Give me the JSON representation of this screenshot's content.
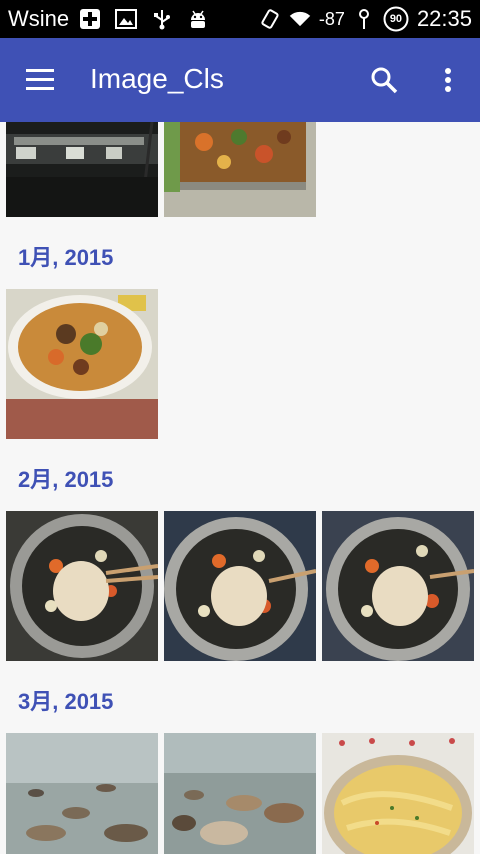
{
  "status_bar": {
    "carrier": "Wsine",
    "signal_text": "-87",
    "battery": "90",
    "time": "22:35"
  },
  "app_bar": {
    "title": "Image_Cls",
    "menu_icon": "hamburger-menu-icon",
    "search_icon": "search-icon",
    "more_icon": "more-vert-icon"
  },
  "sections": [
    {
      "label": "1月, 2015"
    },
    {
      "label": "2月, 2015"
    },
    {
      "label": "3月, 2015"
    }
  ],
  "colors": {
    "primary": "#3f51b5",
    "accent_text": "#3f51b5"
  }
}
